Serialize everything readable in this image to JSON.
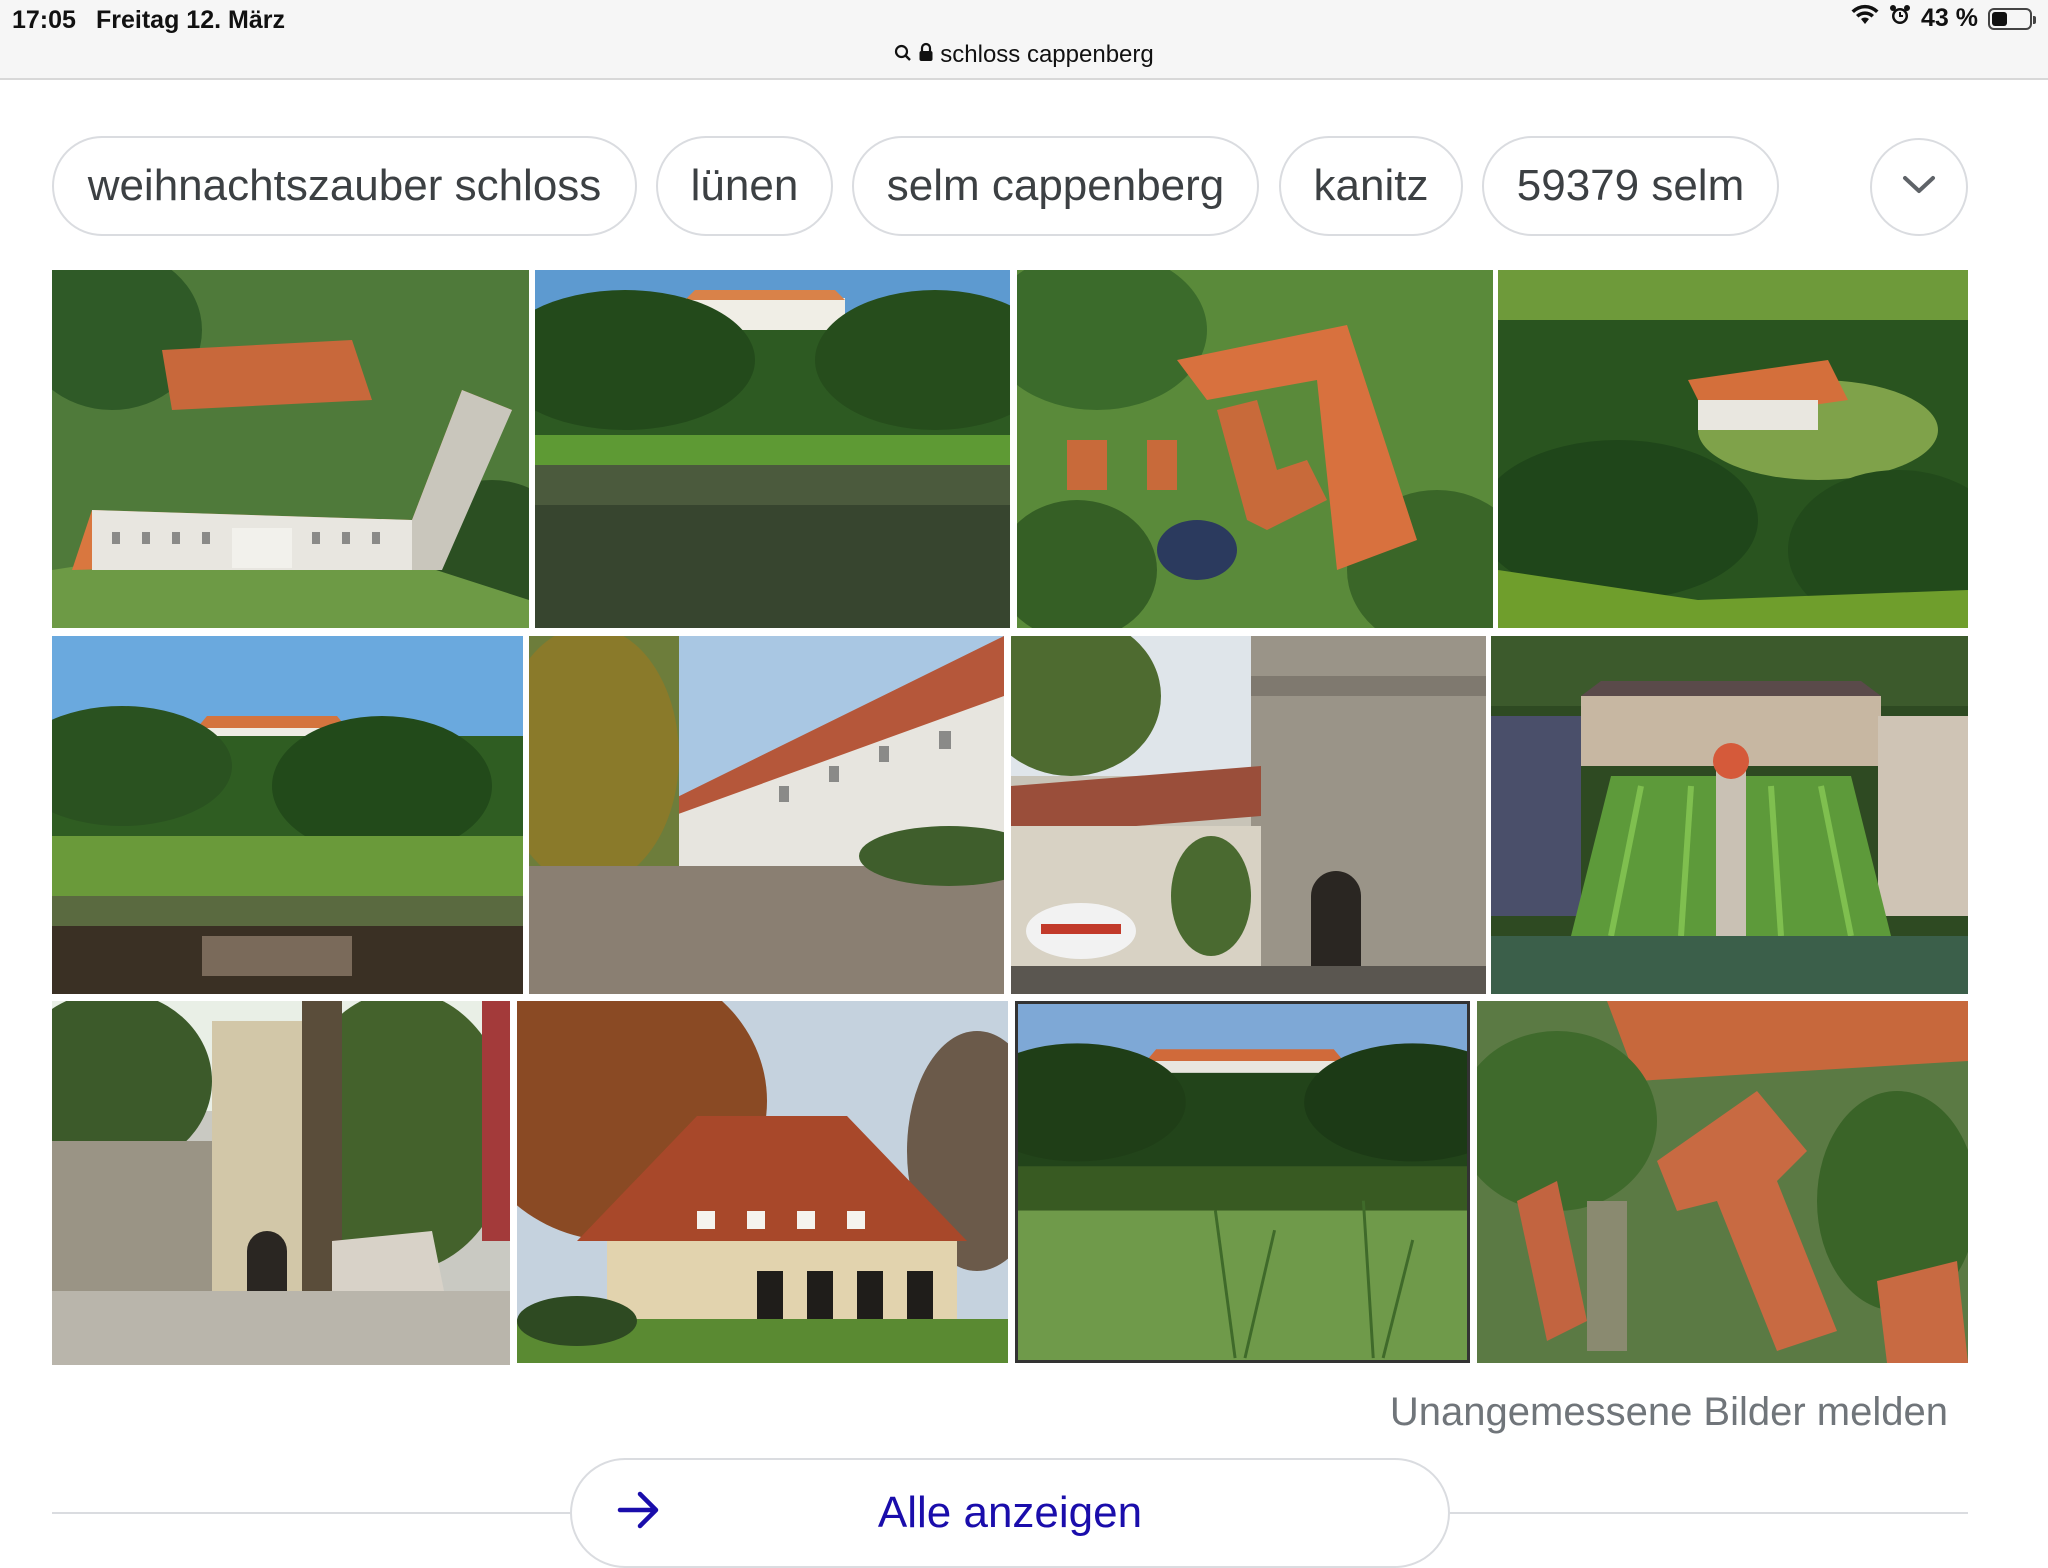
{
  "status_bar": {
    "time": "17:05",
    "date": "Freitag 12. März",
    "battery_text": "43 %",
    "battery_level": 0.43
  },
  "url_bar": {
    "url": "schloss cappenberg",
    "icons": [
      "search-icon",
      "lock-icon"
    ]
  },
  "chips": [
    {
      "label": "weihnachtszauber schloss"
    },
    {
      "label": "lünen"
    },
    {
      "label": "selm cappenberg"
    },
    {
      "label": "kanitz"
    },
    {
      "label": "59379 selm"
    }
  ],
  "chips_more_icon": "chevron-down-icon",
  "image_results": {
    "rows": [
      [
        {
          "subject": "aerial-castle-orange-roof"
        },
        {
          "subject": "castle-across-pond"
        },
        {
          "subject": "aerial-castle-courtyard"
        },
        {
          "subject": "aerial-castle-forest"
        }
      ],
      [
        {
          "subject": "castle-lake-reflection"
        },
        {
          "subject": "castle-wing-courtyard"
        },
        {
          "subject": "tower-and-car"
        },
        {
          "subject": "baroque-palace-garden"
        }
      ],
      [
        {
          "subject": "stone-tower-trees"
        },
        {
          "subject": "half-timbered-house"
        },
        {
          "subject": "castle-field-distance"
        },
        {
          "subject": "aerial-church-roofs"
        }
      ]
    ]
  },
  "report_link": "Unangemessene Bilder melden",
  "show_all": {
    "label": "Alle anzeigen",
    "icon": "arrow-right-icon"
  },
  "colors": {
    "link": "#1a0dab",
    "chip_border": "#dadce0",
    "muted_text": "#70757a"
  }
}
